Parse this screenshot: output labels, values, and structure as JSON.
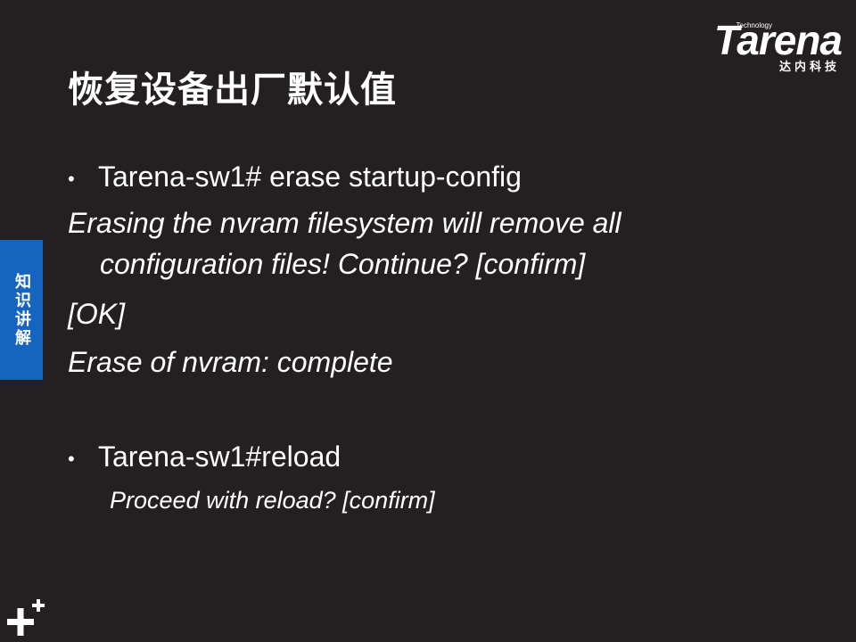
{
  "logo": {
    "technology": "Technology",
    "brand": "Tarena",
    "chinese": "达内科技"
  },
  "title": "恢复设备出厂默认值",
  "side_tab": "知识讲解",
  "content": {
    "bullet1": "Tarena-sw1# erase startup-config",
    "line2": "Erasing the nvram filesystem will remove all",
    "line3": "configuration files! Continue? [confirm]",
    "line4": "[OK]",
    "line5": "Erase of nvram: complete",
    "bullet2": "Tarena-sw1#reload",
    "line7": "Proceed with reload? [confirm]"
  },
  "icons": {
    "corner": "plus-plus-icon"
  }
}
